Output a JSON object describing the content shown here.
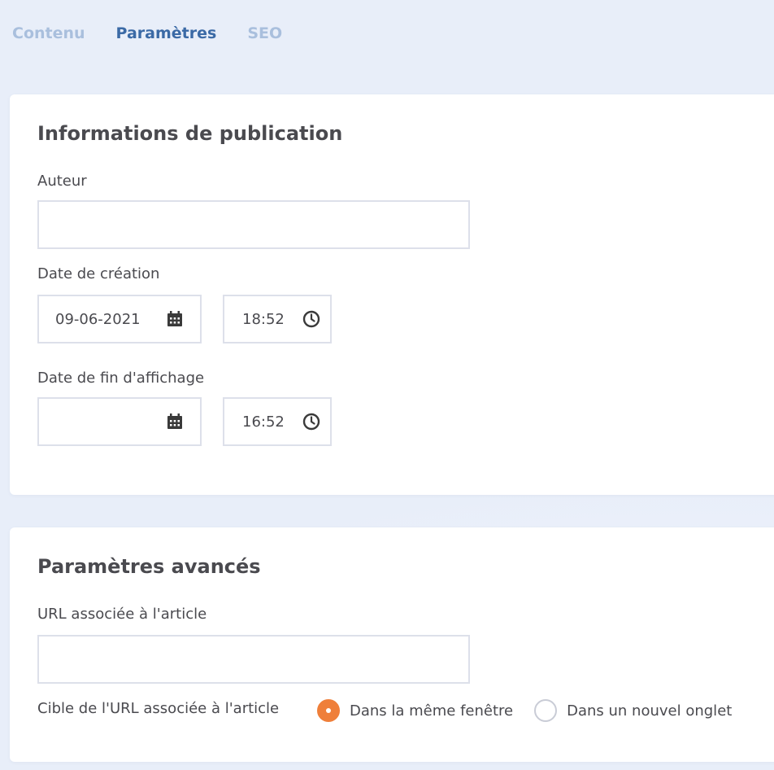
{
  "tabs": [
    {
      "label": "Contenu",
      "active": false
    },
    {
      "label": "Paramètres",
      "active": true
    },
    {
      "label": "SEO",
      "active": false
    }
  ],
  "publication": {
    "title": "Informations de publication",
    "author": {
      "label": "Auteur",
      "value": ""
    },
    "creation": {
      "label": "Date de création",
      "date": "09-06-2021",
      "time": "18:52"
    },
    "end_display": {
      "label": "Date de fin d'affichage",
      "date": "",
      "time": "16:52"
    }
  },
  "advanced": {
    "title": "Paramètres avancés",
    "url": {
      "label": "URL associée à l'article",
      "value": ""
    },
    "target": {
      "label": "Cible de l'URL associée à l'article",
      "options": [
        {
          "label": "Dans la même fenêtre",
          "checked": true
        },
        {
          "label": "Dans un nouvel onglet",
          "checked": false
        }
      ]
    }
  },
  "colors": {
    "accent": "#ef7f3a",
    "active_tab": "#3b6aa6",
    "inactive_tab": "#a9bfdd"
  },
  "icons": {
    "date": "calendar-icon",
    "time": "clock-icon"
  }
}
